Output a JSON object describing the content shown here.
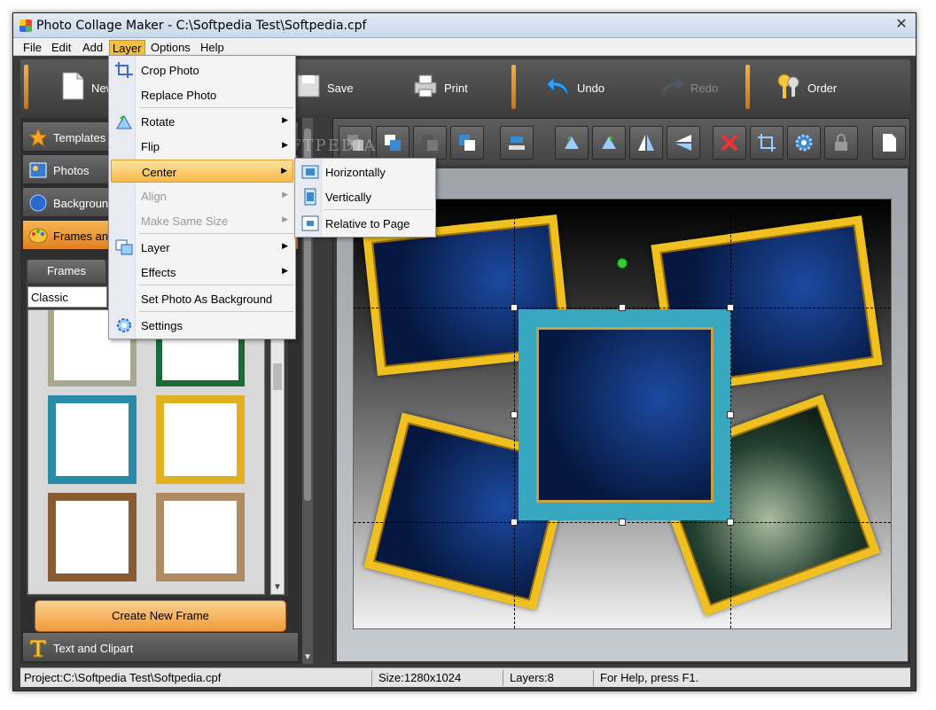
{
  "window": {
    "title": "Photo Collage Maker - C:\\Softpedia Test\\Softpedia.cpf",
    "close_glyph": "✕"
  },
  "menubar": [
    "File",
    "Edit",
    "Add",
    "Layer",
    "Options",
    "Help"
  ],
  "toolbar": {
    "new": "New",
    "save": "Save",
    "print": "Print",
    "undo": "Undo",
    "redo": "Redo",
    "order": "Order"
  },
  "left_panel": {
    "templates": "Templates",
    "photos": "Photos",
    "background": "Background",
    "frames_and": "Frames and",
    "frames_tab": "Frames",
    "frame_style": "Classic",
    "create_new_frame": "Create New Frame",
    "text_and_clipart": "Text and Clipart"
  },
  "layer_menu": {
    "crop_photo": "Crop Photo",
    "replace_photo": "Replace Photo",
    "rotate": "Rotate",
    "flip": "Flip",
    "center": "Center",
    "align": "Align",
    "make_same_size": "Make Same Size",
    "layer": "Layer",
    "effects": "Effects",
    "set_photo_as_background": "Set Photo As Background",
    "settings": "Settings"
  },
  "center_submenu": {
    "horizontally": "Horizontally",
    "vertically": "Vertically",
    "relative_to_page": "Relative to Page"
  },
  "watermark": "SOFTPEDIA",
  "statusbar": {
    "project": "Project:C:\\Softpedia Test\\Softpedia.cpf",
    "size": "Size:1280x1024",
    "layers": "Layers:8",
    "help": "For Help, press F1."
  },
  "colors": {
    "accent": "#f0a040",
    "menu_highlight": "#f8b848",
    "frame_gold": "#f0c020",
    "frame_teal": "#38a8c0"
  }
}
